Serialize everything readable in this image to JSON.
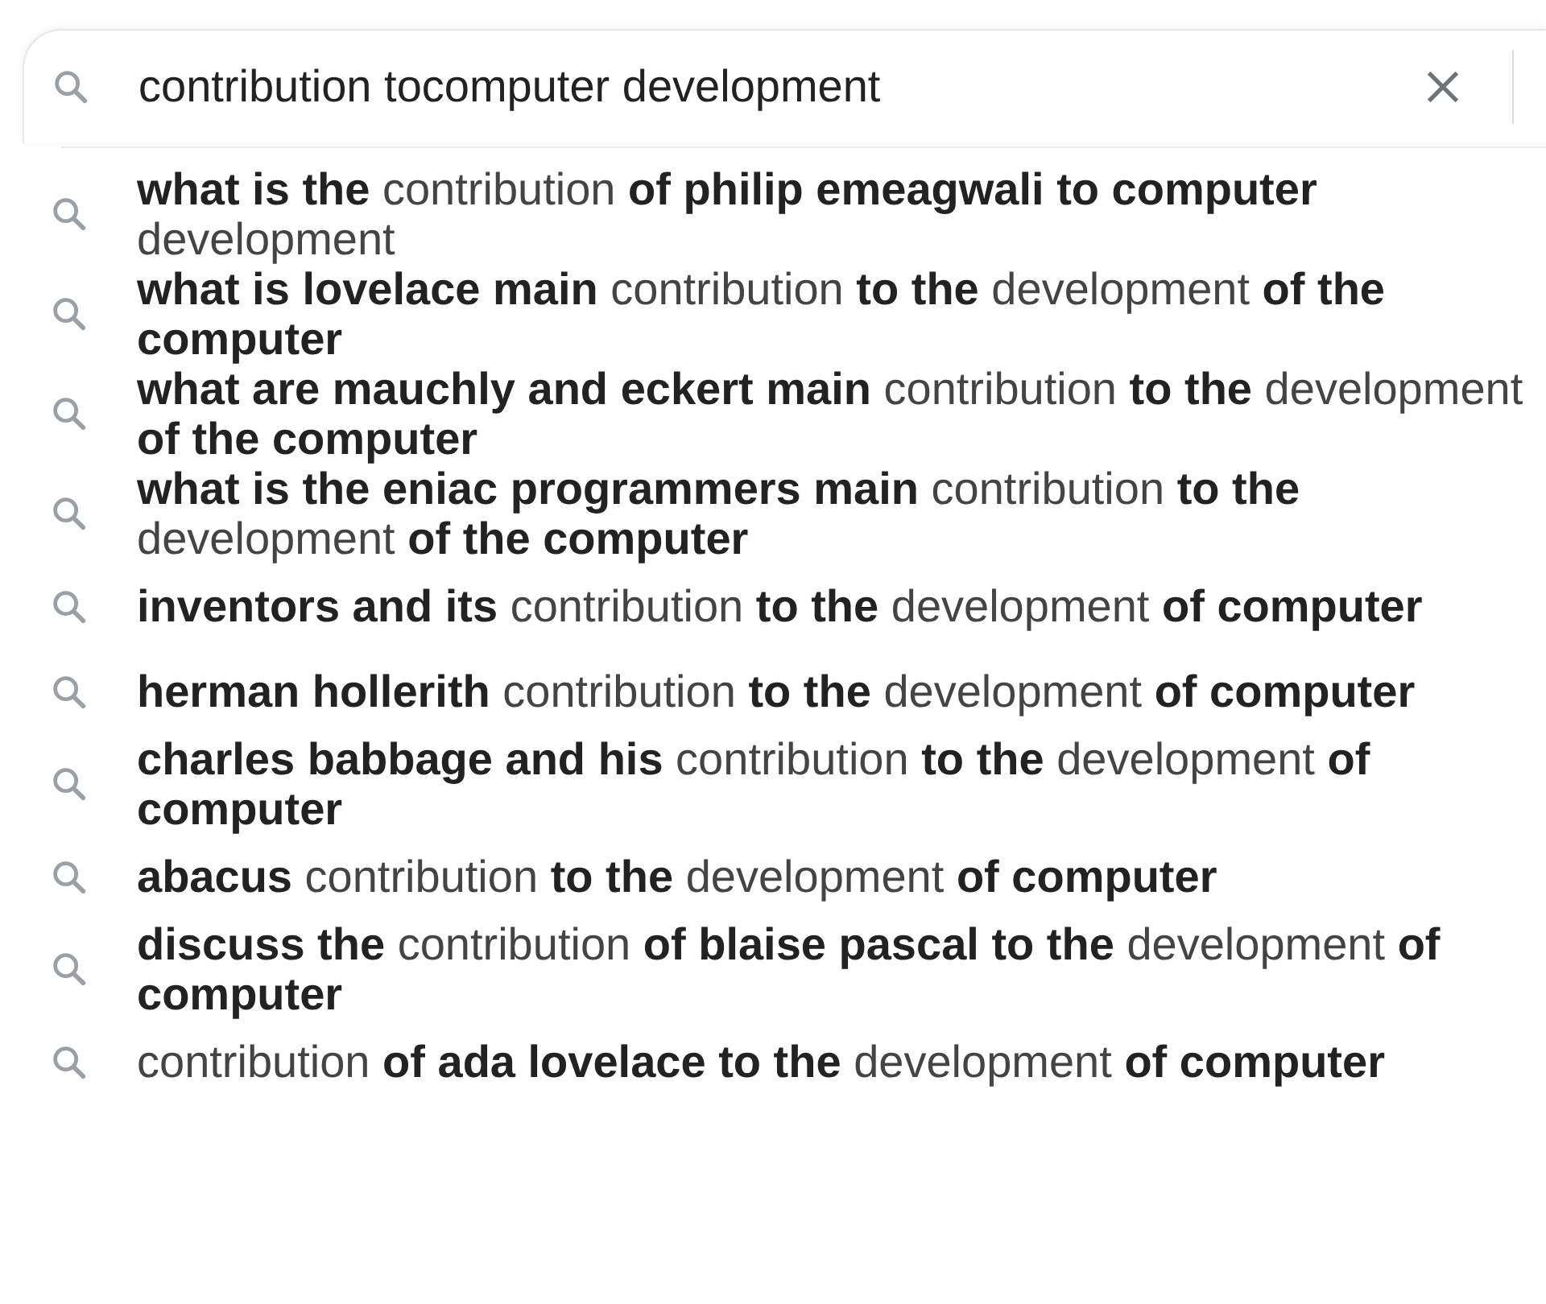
{
  "search": {
    "value": "contribution tocomputer development"
  },
  "suggestions": [
    {
      "text": "**what is the** contribution **of philip emeagwali to computer** development"
    },
    {
      "text": "**what is lovelace main** contribution **to the** development **of the computer**"
    },
    {
      "text": "**what are mauchly and eckert main** contribution **to the** development **of the computer**"
    },
    {
      "text": "**what is the eniac programmers main** contribution **to the** development **of the computer**"
    },
    {
      "text": "**inventors and its** contribution **to the** development **of computer**"
    },
    {
      "text": "**herman hollerith** contribution **to the** development **of computer**"
    },
    {
      "text": "**charles babbage and his** contribution **to the** development **of computer**"
    },
    {
      "text": "**abacus** contribution **to the** development **of computer**"
    },
    {
      "text": "**discuss the** contribution **of blaise pascal to the** development **of computer**"
    },
    {
      "text": "contribution **of ada lovelace to the** development **of computer**"
    }
  ]
}
